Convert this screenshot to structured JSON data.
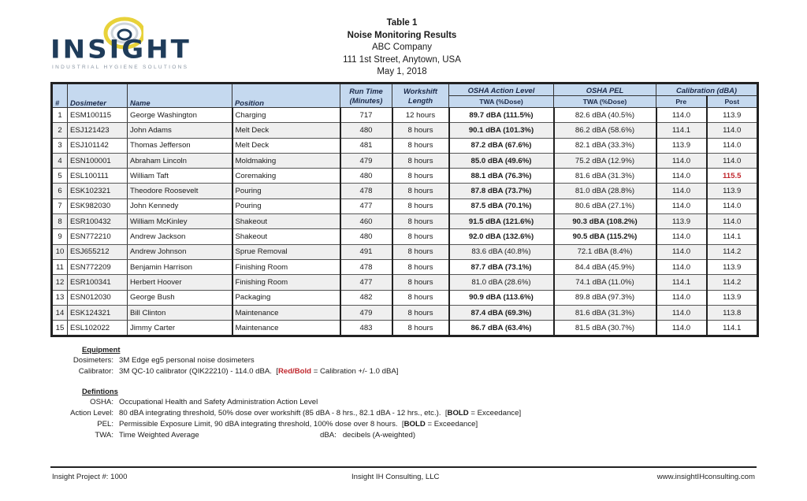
{
  "logo": {
    "wordmark": "INSIGHT",
    "tagline": "INDUSTRIAL HYGIENE SOLUTIONS",
    "colors": {
      "navy": "#1f3c5a",
      "yellow": "#e8d23a",
      "gray": "#8a96a3"
    }
  },
  "header": {
    "table_label": "Table 1",
    "title": "Noise Monitoring Results",
    "company": "ABC Company",
    "address": "111 1st Street, Anytown, USA",
    "date": "May 1, 2018"
  },
  "table": {
    "headers": {
      "num": "#",
      "dosimeter": "Dosimeter",
      "name": "Name",
      "position": "Position",
      "run_time": "Run Time (Minutes)",
      "workshift": "Workshift Length",
      "action_level": "OSHA Action Level",
      "action_level_sub": "TWA (%Dose)",
      "pel": "OSHA PEL",
      "pel_sub": "TWA (%Dose)",
      "calibration": "Calibration (dBA)",
      "pre": "Pre",
      "post": "Post"
    },
    "rows": [
      {
        "num": "1",
        "dosimeter": "ESM100115",
        "name": "George Washington",
        "position": "Charging",
        "run_time": "717",
        "workshift": "12 hours",
        "action_level": "89.7 dBA (111.5%)",
        "action_bold": true,
        "pel": "82.6 dBA (40.5%)",
        "pel_bold": false,
        "pre": "114.0",
        "post": "113.9",
        "post_flag": false
      },
      {
        "num": "2",
        "dosimeter": "ESJ121423",
        "name": "John Adams",
        "position": "Melt Deck",
        "run_time": "480",
        "workshift": "8 hours",
        "action_level": "90.1 dBA (101.3%)",
        "action_bold": true,
        "pel": "86.2 dBA (58.6%)",
        "pel_bold": false,
        "pre": "114.1",
        "post": "114.0",
        "post_flag": false
      },
      {
        "num": "3",
        "dosimeter": "ESJ101142",
        "name": "Thomas Jefferson",
        "position": "Melt Deck",
        "run_time": "481",
        "workshift": "8 hours",
        "action_level": "87.2 dBA (67.6%)",
        "action_bold": true,
        "pel": "82.1 dBA (33.3%)",
        "pel_bold": false,
        "pre": "113.9",
        "post": "114.0",
        "post_flag": false
      },
      {
        "num": "4",
        "dosimeter": "ESN100001",
        "name": "Abraham Lincoln",
        "position": "Moldmaking",
        "run_time": "479",
        "workshift": "8 hours",
        "action_level": "85.0 dBA (49.6%)",
        "action_bold": true,
        "pel": "75.2 dBA (12.9%)",
        "pel_bold": false,
        "pre": "114.0",
        "post": "114.0",
        "post_flag": false
      },
      {
        "num": "5",
        "dosimeter": "ESL100111",
        "name": "William Taft",
        "position": "Coremaking",
        "run_time": "480",
        "workshift": "8 hours",
        "action_level": "88.1 dBA (76.3%)",
        "action_bold": true,
        "pel": "81.6 dBA (31.3%)",
        "pel_bold": false,
        "pre": "114.0",
        "post": "115.5",
        "post_flag": true
      },
      {
        "num": "6",
        "dosimeter": "ESK102321",
        "name": "Theodore Roosevelt",
        "position": "Pouring",
        "run_time": "478",
        "workshift": "8 hours",
        "action_level": "87.8 dBA (73.7%)",
        "action_bold": true,
        "pel": "81.0 dBA (28.8%)",
        "pel_bold": false,
        "pre": "114.0",
        "post": "113.9",
        "post_flag": false
      },
      {
        "num": "7",
        "dosimeter": "ESK982030",
        "name": "John Kennedy",
        "position": "Pouring",
        "run_time": "477",
        "workshift": "8 hours",
        "action_level": "87.5 dBA (70.1%)",
        "action_bold": true,
        "pel": "80.6 dBA (27.1%)",
        "pel_bold": false,
        "pre": "114.0",
        "post": "114.0",
        "post_flag": false
      },
      {
        "num": "8",
        "dosimeter": "ESR100432",
        "name": "William McKinley",
        "position": "Shakeout",
        "run_time": "460",
        "workshift": "8 hours",
        "action_level": "91.5 dBA (121.6%)",
        "action_bold": true,
        "pel": "90.3 dBA (108.2%)",
        "pel_bold": true,
        "pre": "113.9",
        "post": "114.0",
        "post_flag": false
      },
      {
        "num": "9",
        "dosimeter": "ESN772210",
        "name": "Andrew Jackson",
        "position": "Shakeout",
        "run_time": "480",
        "workshift": "8 hours",
        "action_level": "92.0 dBA (132.6%)",
        "action_bold": true,
        "pel": "90.5 dBA (115.2%)",
        "pel_bold": true,
        "pre": "114.0",
        "post": "114.1",
        "post_flag": false
      },
      {
        "num": "10",
        "dosimeter": "ESJ655212",
        "name": "Andrew Johnson",
        "position": "Sprue Removal",
        "run_time": "491",
        "workshift": "8 hours",
        "action_level": "83.6 dBA (40.8%)",
        "action_bold": false,
        "pel": "72.1 dBA (8.4%)",
        "pel_bold": false,
        "pre": "114.0",
        "post": "114.2",
        "post_flag": false
      },
      {
        "num": "11",
        "dosimeter": "ESN772209",
        "name": "Benjamin Harrison",
        "position": "Finishing Room",
        "run_time": "478",
        "workshift": "8 hours",
        "action_level": "87.7 dBA (73.1%)",
        "action_bold": true,
        "pel": "84.4 dBA (45.9%)",
        "pel_bold": false,
        "pre": "114.0",
        "post": "113.9",
        "post_flag": false
      },
      {
        "num": "12",
        "dosimeter": "ESR100341",
        "name": "Herbert Hoover",
        "position": "Finishing Room",
        "run_time": "477",
        "workshift": "8 hours",
        "action_level": "81.0 dBA (28.6%)",
        "action_bold": false,
        "pel": "74.1 dBA (11.0%)",
        "pel_bold": false,
        "pre": "114.1",
        "post": "114.2",
        "post_flag": false
      },
      {
        "num": "13",
        "dosimeter": "ESN012030",
        "name": "George Bush",
        "position": "Packaging",
        "run_time": "482",
        "workshift": "8 hours",
        "action_level": "90.9 dBA (113.6%)",
        "action_bold": true,
        "pel": "89.8 dBA (97.3%)",
        "pel_bold": false,
        "pre": "114.0",
        "post": "113.9",
        "post_flag": false
      },
      {
        "num": "14",
        "dosimeter": "ESK124321",
        "name": "Bill Clinton",
        "position": "Maintenance",
        "run_time": "479",
        "workshift": "8 hours",
        "action_level": "87.4 dBA (69.3%)",
        "action_bold": true,
        "pel": "81.6 dBA (31.3%)",
        "pel_bold": false,
        "pre": "114.0",
        "post": "113.8",
        "post_flag": false
      },
      {
        "num": "15",
        "dosimeter": "ESL102022",
        "name": "Jimmy Carter",
        "position": "Maintenance",
        "run_time": "483",
        "workshift": "8 hours",
        "action_level": "86.7 dBA (63.4%)",
        "action_bold": true,
        "pel": "81.5 dBA (30.7%)",
        "pel_bold": false,
        "pre": "114.0",
        "post": "114.1",
        "post_flag": false
      }
    ],
    "colors": {
      "header_bg": "#c5d9ef",
      "stripe_bg": "#efefef",
      "flag_red": "#c0262c"
    }
  },
  "equipment": {
    "heading": "Equipment",
    "dosimeters_label": "Dosimeters:",
    "dosimeters_value": "3M Edge eg5 personal noise dosimeters",
    "calibrator_label": "Calibrator:",
    "calibrator_value": "3M QC-10 calibrator (QIK22210) - 114.0 dBA.",
    "calibrator_note_open": "[",
    "calibrator_note_key": "Red/Bold",
    "calibrator_note_rest": " = Calibration +/- 1.0 dBA]"
  },
  "definitions": {
    "heading": "Defintions",
    "osha_label": "OSHA:",
    "osha_value": "Occupational Health and Safety Administration Action Level",
    "action_label": "Action Level:",
    "action_value": "80 dBA integrating threshold, 50% dose over workshift (85 dBA - 8 hrs., 82.1 dBA - 12 hrs., etc.).",
    "action_note_key": "BOLD",
    "action_note_rest": " = Exceedance]",
    "pel_label": "PEL:",
    "pel_value": "Permissible Exposure Limit, 90 dBA integrating threshold, 100% dose over 8 hours.",
    "pel_note_key": "BOLD",
    "pel_note_rest": " = Exceedance]",
    "note_open": "[",
    "twa_label": "TWA:",
    "twa_value": "Time Weighted Average",
    "dba_label": "dBA:",
    "dba_value": "decibels (A-weighted)"
  },
  "footer": {
    "project": "Insight Project #: 1000",
    "company": "Insight IH Consulting, LLC",
    "website": "www.insightIHconsulting.com"
  }
}
